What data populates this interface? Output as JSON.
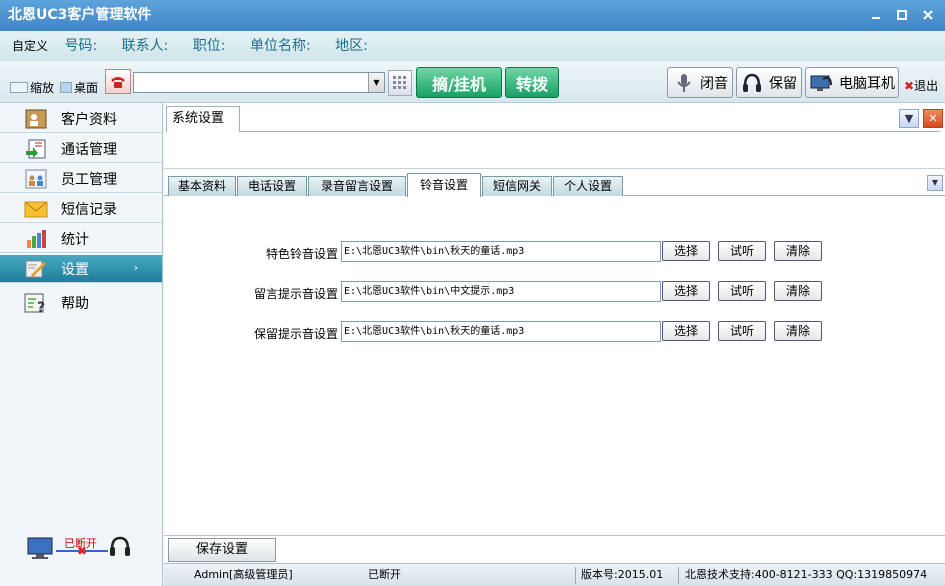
{
  "app": {
    "title": "北恩UC3客户管理软件"
  },
  "window_controls": {
    "minimize": "▁",
    "maximize": "▪",
    "close": "✕"
  },
  "info_bar": {
    "custom": "自定义",
    "fields": [
      "号码:",
      "联系人:",
      "职位:",
      "单位名称:",
      "地区:"
    ]
  },
  "toolbar": {
    "shrink_label": "缩放",
    "desktop_label": "桌面",
    "dial_value": "",
    "pickup_label": "摘/挂机",
    "transfer_label": "转拨",
    "mute_label": "闭音",
    "hold_label": "保留",
    "headset_label": "电脑耳机",
    "exit_label": "退出"
  },
  "sidebar": {
    "items": [
      {
        "label": "客户资料",
        "icon": "contacts-icon"
      },
      {
        "label": "通话管理",
        "icon": "call-log-icon"
      },
      {
        "label": "员工管理",
        "icon": "staff-icon"
      },
      {
        "label": "短信记录",
        "icon": "envelope-icon"
      },
      {
        "label": "统计",
        "icon": "bar-chart-icon"
      },
      {
        "label": "设置",
        "icon": "settings-icon"
      },
      {
        "label": "帮助",
        "icon": "help-icon"
      }
    ],
    "active_index": 5,
    "connection_status": "已断开"
  },
  "main": {
    "tab_title": "系统设置",
    "subtabs": [
      "基本资料",
      "电话设置",
      "录音留言设置",
      "铃音设置",
      "短信网关",
      "个人设置"
    ],
    "active_subtab": 3,
    "rows": [
      {
        "label": "特色铃音设置",
        "value": "E:\\北恩UC3软件\\bin\\秋天的童话.mp3"
      },
      {
        "label": "留言提示音设置",
        "value": "E:\\北恩UC3软件\\bin\\中文提示.mp3"
      },
      {
        "label": "保留提示音设置",
        "value": "E:\\北恩UC3软件\\bin\\秋天的童话.mp3"
      }
    ],
    "row_buttons": {
      "choose": "选择",
      "listen": "试听",
      "clear": "清除"
    },
    "save_label": "保存设置"
  },
  "statusbar": {
    "user": "Admin[高级管理员]",
    "connection": "已断开",
    "version": "版本号:2015.01",
    "support": "北恩技术支持:400-8121-333 QQ:1319850974"
  },
  "colors": {
    "accent_green": "#18a065",
    "active_nav": "#1b7f9b",
    "title_blue": "#3f86c8"
  }
}
